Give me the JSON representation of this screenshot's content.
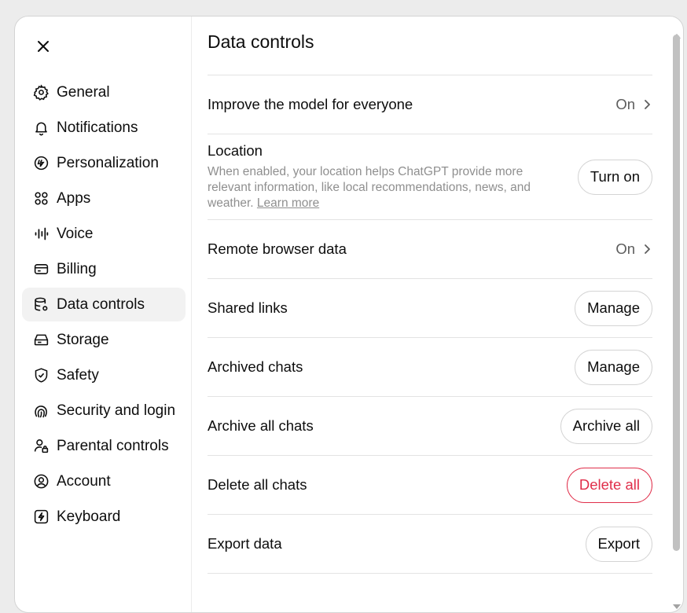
{
  "sidebar": {
    "close_icon": "close-icon",
    "items": [
      {
        "label": "General",
        "icon": "gear-icon"
      },
      {
        "label": "Notifications",
        "icon": "bell-icon"
      },
      {
        "label": "Personalization",
        "icon": "personalization-icon"
      },
      {
        "label": "Apps",
        "icon": "apps-grid-icon"
      },
      {
        "label": "Voice",
        "icon": "waveform-icon"
      },
      {
        "label": "Billing",
        "icon": "card-icon"
      },
      {
        "label": "Data controls",
        "icon": "database-gear-icon",
        "active": true
      },
      {
        "label": "Storage",
        "icon": "storage-drive-icon"
      },
      {
        "label": "Safety",
        "icon": "shield-check-icon"
      },
      {
        "label": "Security and login",
        "icon": "fingerprint-icon"
      },
      {
        "label": "Parental controls",
        "icon": "person-lock-icon"
      },
      {
        "label": "Account",
        "icon": "account-circle-icon"
      },
      {
        "label": "Keyboard",
        "icon": "keyboard-bolt-icon"
      }
    ]
  },
  "main": {
    "title": "Data controls",
    "rows": {
      "improve": {
        "label": "Improve the model for everyone",
        "value": "On"
      },
      "location": {
        "label": "Location",
        "description": "When enabled, your location helps ChatGPT provide more relevant information, like local recommendations, news, and weather.",
        "link": "Learn more",
        "button": "Turn on"
      },
      "remote_browser": {
        "label": "Remote browser data",
        "value": "On"
      },
      "shared_links": {
        "label": "Shared links",
        "button": "Manage"
      },
      "archived_chats": {
        "label": "Archived chats",
        "button": "Manage"
      },
      "archive_all": {
        "label": "Archive all chats",
        "button": "Archive all"
      },
      "delete_all": {
        "label": "Delete all chats",
        "button": "Delete all"
      },
      "export": {
        "label": "Export data",
        "button": "Export"
      }
    }
  },
  "colors": {
    "danger": "#e02e4a",
    "active_bg": "#f2f2f2",
    "muted": "#8f8f8f"
  }
}
